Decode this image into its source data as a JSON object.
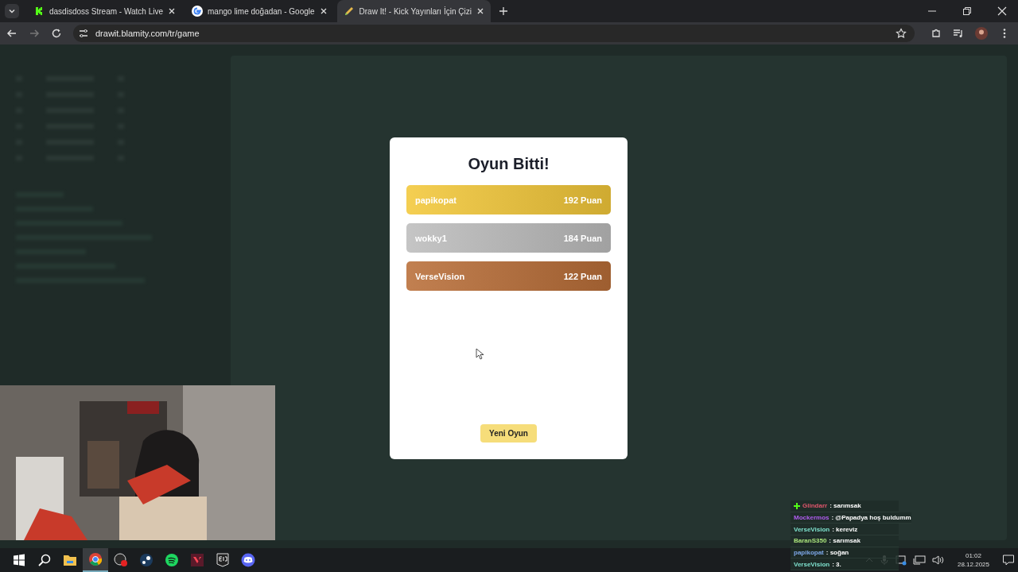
{
  "browser": {
    "tabs": [
      {
        "title": "dasdisdoss Stream - Watch Live",
        "kind": "kick",
        "selected": false
      },
      {
        "title": "mango lime doğadan - Google",
        "kind": "google",
        "selected": false
      },
      {
        "title": "Draw It! - Kick Yayınları İçin Çizi",
        "kind": "drawit",
        "selected": true
      }
    ],
    "url": "drawit.blamity.com/tr/game"
  },
  "modal": {
    "title": "Oyun Bitti!",
    "results": [
      {
        "name": "papikopat",
        "score": "192 Puan",
        "color": "#f3c83a"
      },
      {
        "name": "wokky1",
        "score": "184 Puan",
        "color": "#bdbdbd"
      },
      {
        "name": "VerseVision",
        "score": "122 Puan",
        "color": "#b96e38"
      }
    ],
    "button": "Yeni Oyun"
  },
  "chat": [
    {
      "user": "Glindarr",
      "message": ": sarımsak",
      "color": "#e0566c",
      "badge": true
    },
    {
      "user": "Mockermos",
      "message": ": @Papadya hoş buldumm",
      "color": "#b05cf0",
      "badge": false
    },
    {
      "user": "VerseVision",
      "message": ": kereviz",
      "color": "#7fe3cf",
      "badge": false
    },
    {
      "user": "BaranS350",
      "message": ": sarımsak",
      "color": "#a9e37b",
      "badge": false
    },
    {
      "user": "papikopat",
      "message": ": soğan",
      "color": "#7da7e6",
      "badge": false
    },
    {
      "user": "VerseVision",
      "message": ": 3.",
      "color": "#7fe3cf",
      "badge": false
    }
  ],
  "taskbar": {
    "apps": [
      {
        "kind": "explorer",
        "selected": false
      },
      {
        "kind": "chrome",
        "selected": true
      },
      {
        "kind": "obs",
        "selected": false
      },
      {
        "kind": "steam",
        "selected": false
      },
      {
        "kind": "spotify",
        "selected": false
      },
      {
        "kind": "valorant",
        "selected": false
      },
      {
        "kind": "epic",
        "selected": false
      },
      {
        "kind": "discord",
        "selected": false
      }
    ],
    "time": "01:02",
    "date": "28.12.2025"
  }
}
